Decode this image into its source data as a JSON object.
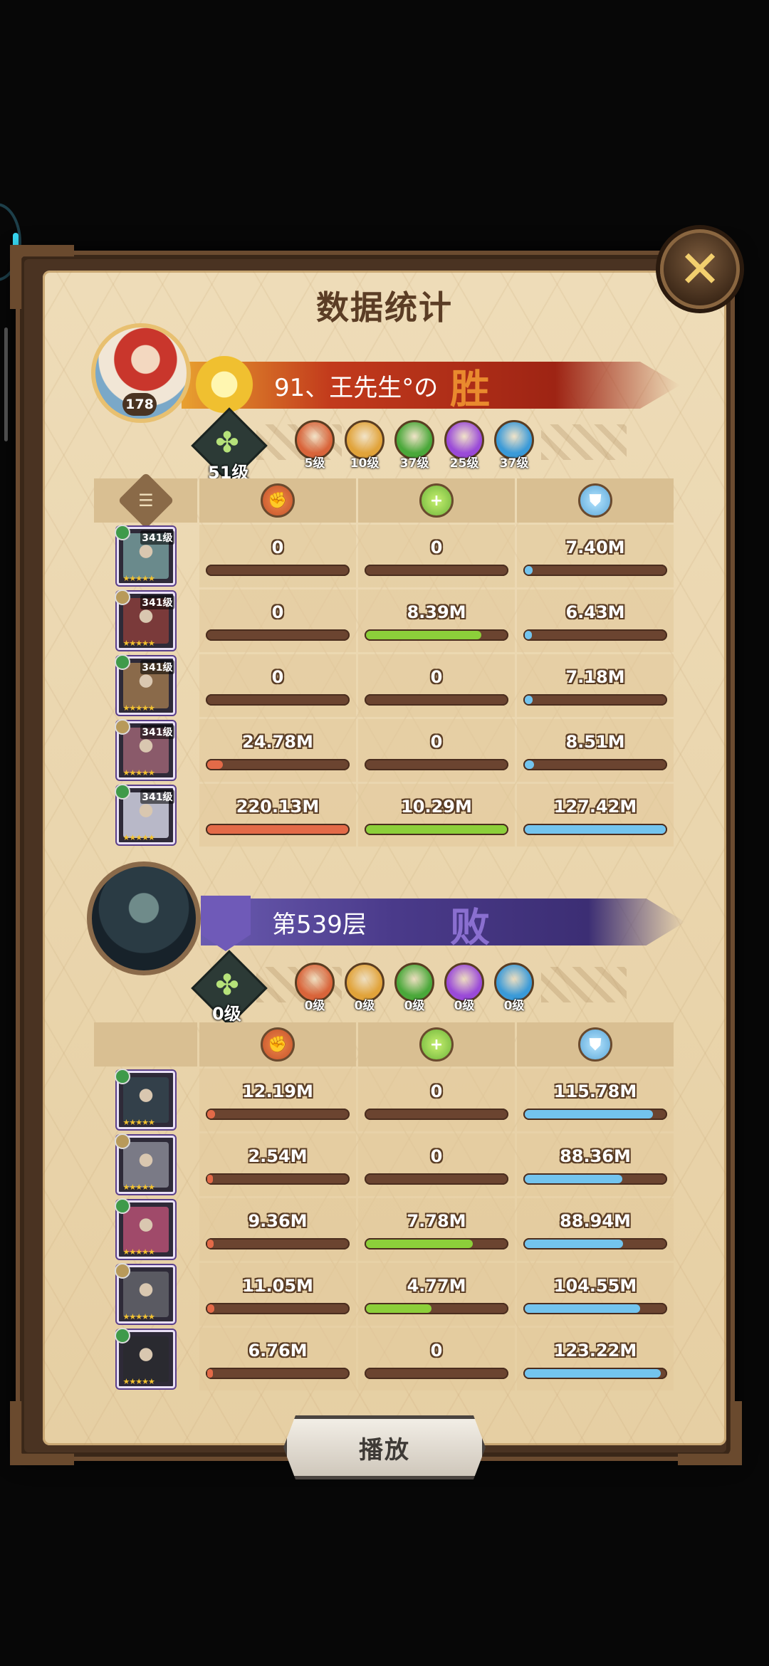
{
  "title": "数据统计",
  "play_label": "播放",
  "colors": {
    "damage": "#e36a48",
    "heal": "#8ccf3a",
    "defense": "#73c4ee"
  },
  "team1": {
    "player_level": "178",
    "banner_text": "91、王先生°の",
    "result": "胜",
    "hero_level": "51级",
    "factions": [
      {
        "icon": "lightbearer-icon",
        "label": "5级",
        "color": "#d9643a"
      },
      {
        "icon": "mauler-icon",
        "label": "10级",
        "color": "#e1a33a"
      },
      {
        "icon": "wilder-icon",
        "label": "37级",
        "color": "#4aa83a"
      },
      {
        "icon": "graveborn-icon",
        "label": "25级",
        "color": "#9a4ad8"
      },
      {
        "icon": "celestial-icon",
        "label": "37级",
        "color": "#3a9ad8"
      }
    ],
    "heroes": [
      {
        "level": "341级",
        "damage": "0",
        "heal": "0",
        "defense": "7.40M",
        "dmg_pct": 0,
        "heal_pct": 0,
        "def_pct": 0.058
      },
      {
        "level": "341级",
        "damage": "0",
        "heal": "8.39M",
        "defense": "6.43M",
        "dmg_pct": 0,
        "heal_pct": 0.816,
        "def_pct": 0.05
      },
      {
        "level": "341级",
        "damage": "0",
        "heal": "0",
        "defense": "7.18M",
        "dmg_pct": 0,
        "heal_pct": 0,
        "def_pct": 0.056
      },
      {
        "level": "341级",
        "damage": "24.78M",
        "heal": "0",
        "defense": "8.51M",
        "dmg_pct": 0.113,
        "heal_pct": 0,
        "def_pct": 0.067
      },
      {
        "level": "341级",
        "damage": "220.13M",
        "heal": "10.29M",
        "defense": "127.42M",
        "dmg_pct": 1.0,
        "heal_pct": 1.0,
        "def_pct": 1.0
      }
    ]
  },
  "team2": {
    "banner_text": "第539层",
    "result": "败",
    "hero_level": "0级",
    "factions": [
      {
        "icon": "lightbearer-icon",
        "label": "0级",
        "color": "#d9643a"
      },
      {
        "icon": "mauler-icon",
        "label": "0级",
        "color": "#e1a33a"
      },
      {
        "icon": "wilder-icon",
        "label": "0级",
        "color": "#4aa83a"
      },
      {
        "icon": "graveborn-icon",
        "label": "0级",
        "color": "#9a4ad8"
      },
      {
        "icon": "celestial-icon",
        "label": "0级",
        "color": "#3a9ad8"
      }
    ],
    "heroes": [
      {
        "damage": "12.19M",
        "heal": "0",
        "defense": "115.78M",
        "dmg_pct": 0.055,
        "heal_pct": 0,
        "def_pct": 0.908
      },
      {
        "damage": "2.54M",
        "heal": "0",
        "defense": "88.36M",
        "dmg_pct": 0.012,
        "heal_pct": 0,
        "def_pct": 0.693
      },
      {
        "damage": "9.36M",
        "heal": "7.78M",
        "defense": "88.94M",
        "dmg_pct": 0.043,
        "heal_pct": 0.756,
        "def_pct": 0.698
      },
      {
        "damage": "11.05M",
        "heal": "4.77M",
        "defense": "104.55M",
        "dmg_pct": 0.05,
        "heal_pct": 0.464,
        "def_pct": 0.82
      },
      {
        "damage": "6.76M",
        "heal": "0",
        "defense": "123.22M",
        "dmg_pct": 0.031,
        "heal_pct": 0,
        "def_pct": 0.967
      }
    ]
  }
}
